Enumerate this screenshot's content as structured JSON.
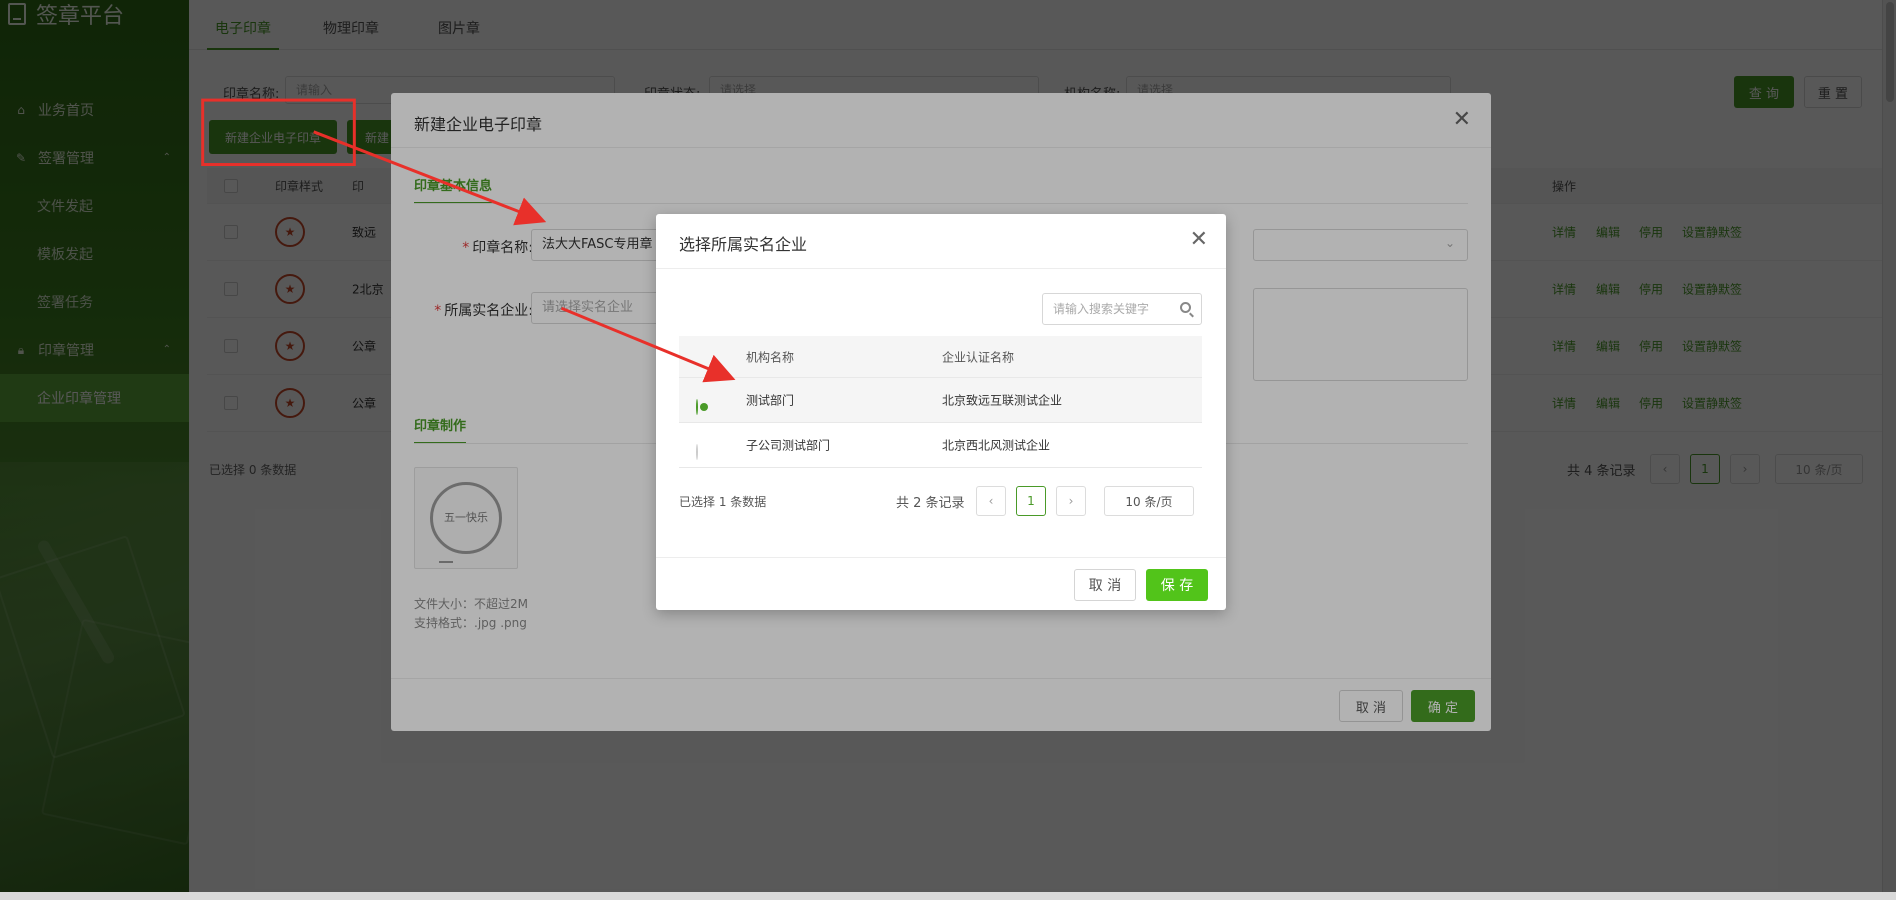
{
  "brand": {
    "title": "签章平台"
  },
  "sidebar": {
    "items": [
      {
        "label": "业务首页",
        "icon": "home-icon"
      },
      {
        "label": "签署管理",
        "icon": "edit-doc-icon",
        "expanded": true,
        "children": [
          "文件发起",
          "模板发起",
          "签署任务"
        ]
      },
      {
        "label": "印章管理",
        "icon": "lock-icon",
        "expanded": true,
        "children": [
          "企业印章管理"
        ]
      }
    ],
    "active": "企业印章管理"
  },
  "tabs": [
    "电子印章",
    "物理印章",
    "图片章"
  ],
  "filters": {
    "name_label": "印章名称:",
    "name_placeholder": "请输入",
    "status_label": "印章状态:",
    "status_placeholder": "请选择",
    "org_label": "机构名称:",
    "org_placeholder": "请选择",
    "query": "查 询",
    "reset": "重 置"
  },
  "actions": {
    "new_seal": "新建企业电子印章",
    "new_other": "新建"
  },
  "bg_table": {
    "headers": [
      "印章样式",
      "印"
    ],
    "op_header": "操作",
    "rows": [
      {
        "name": "致远",
        "ops": [
          "详情",
          "编辑",
          "停用",
          "设置静默签"
        ]
      },
      {
        "name": "2北京",
        "ops": [
          "详情",
          "编辑",
          "停用",
          "设置静默签"
        ]
      },
      {
        "name": "公章",
        "ops": [
          "详情",
          "编辑",
          "停用",
          "设置静默签"
        ]
      },
      {
        "name": "公章",
        "ops": [
          "详情",
          "编辑",
          "停用",
          "设置静默签"
        ]
      }
    ],
    "selected": "已选择 0 条数据",
    "total": "共 4 条记录",
    "page": "1",
    "page_size": "10 条/页"
  },
  "dialog1": {
    "title": "新建企业电子印章",
    "section_basic": "印章基本信息",
    "seal_name_label": "印章名称:",
    "seal_name_value": "法大大FASC专用章",
    "company_label": "所属实名企业:",
    "company_placeholder": "请选择实名企业",
    "section_make": "印章制作",
    "seal_text": "五一快乐",
    "file_size_hint": "文件大小：不超过2M",
    "format_hint": "支持格式：.jpg .png",
    "cancel": "取 消",
    "confirm": "确 定"
  },
  "dialog2": {
    "title": "选择所属实名企业",
    "search_placeholder": "请输入搜索关键字",
    "headers": [
      "机构名称",
      "企业认证名称"
    ],
    "rows": [
      {
        "org": "测试部门",
        "company": "北京致远互联测试企业",
        "selected": true
      },
      {
        "org": "子公司测试部门",
        "company": "北京西北风测试企业",
        "selected": false
      }
    ],
    "selected": "已选择 1 条数据",
    "total": "共 2 条记录",
    "page": "1",
    "page_size": "10 条/页",
    "cancel": "取 消",
    "save": "保 存"
  },
  "colors": {
    "accent": "#4a9a28",
    "save_button": "#52c41a",
    "annotation": "#e8302a"
  }
}
